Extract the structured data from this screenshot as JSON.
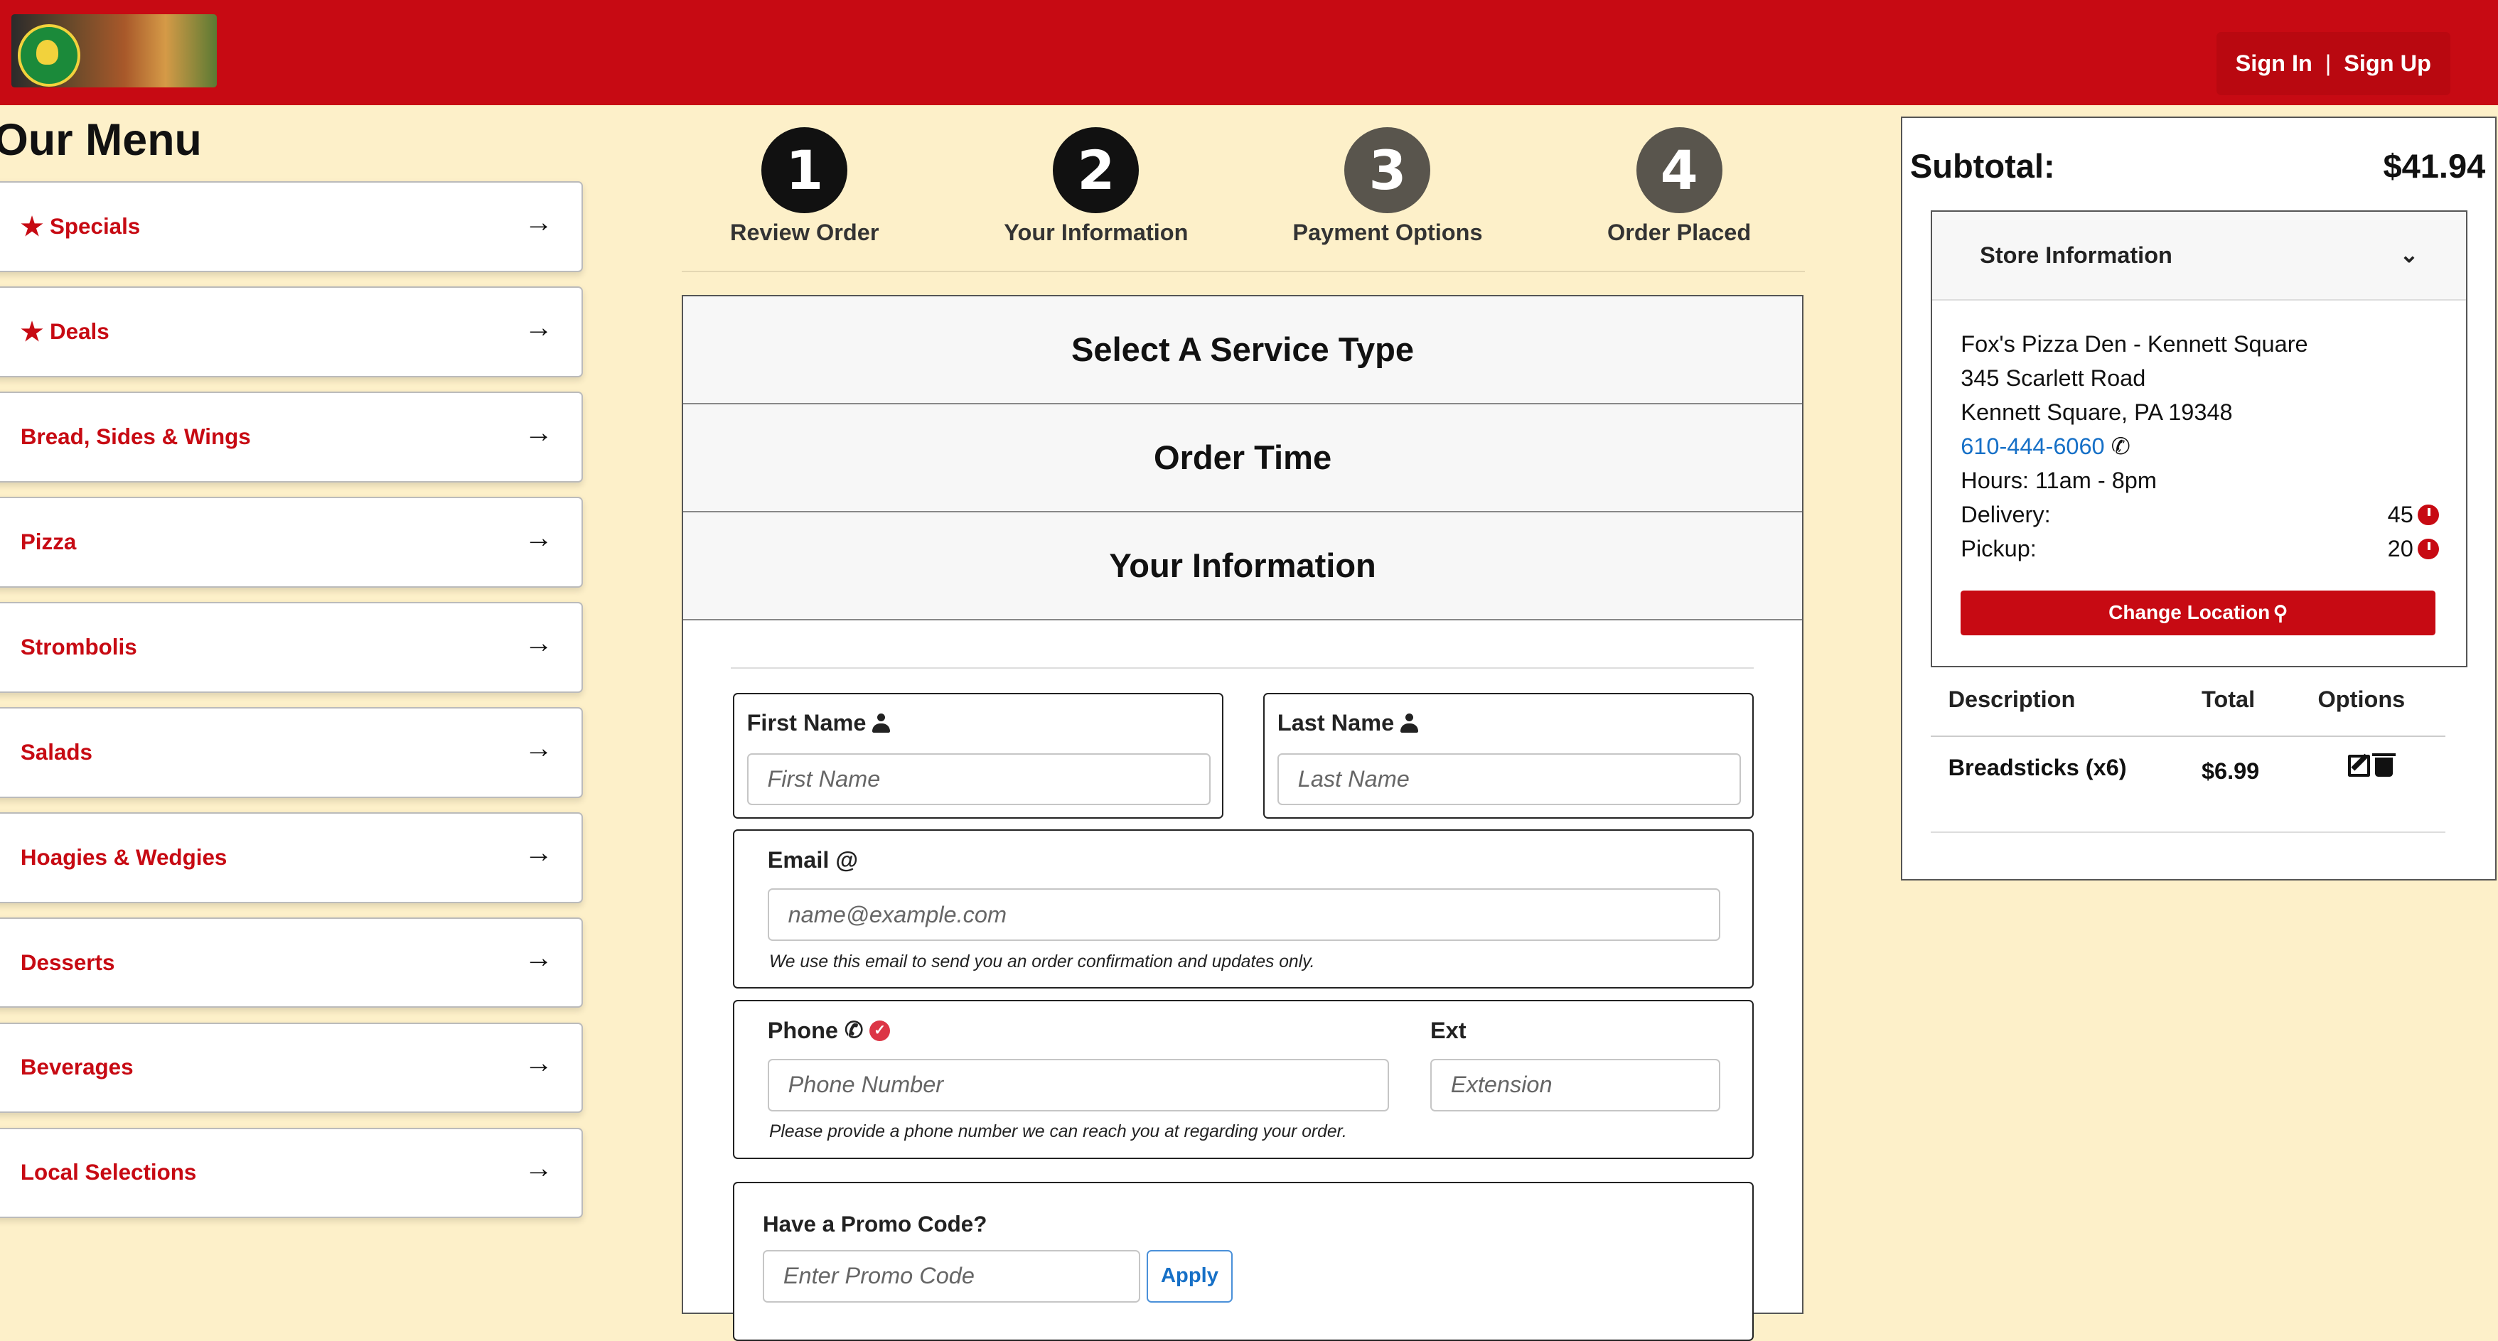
{
  "header": {
    "logo_alt": "Fox's Pizza Den",
    "sign_in": "Sign In",
    "separator": "|",
    "sign_up": "Sign Up"
  },
  "menu": {
    "title": "Our Menu",
    "items": [
      {
        "label": "Specials",
        "icon": "star-icon"
      },
      {
        "label": "Deals",
        "icon": "star-icon"
      },
      {
        "label": "Bread, Sides & Wings"
      },
      {
        "label": "Pizza"
      },
      {
        "label": "Strombolis"
      },
      {
        "label": "Salads"
      },
      {
        "label": "Hoagies & Wedgies"
      },
      {
        "label": "Desserts"
      },
      {
        "label": "Beverages"
      },
      {
        "label": "Local Selections"
      }
    ]
  },
  "steps": [
    {
      "number": "1",
      "label": "Review Order",
      "state": "complete"
    },
    {
      "number": "2",
      "label": "Your Information",
      "state": "current"
    },
    {
      "number": "3",
      "label": "Payment Options",
      "state": "pending"
    },
    {
      "number": "4",
      "label": "Order Placed",
      "state": "pending"
    }
  ],
  "checkout": {
    "section_service": "Select A Service Type",
    "section_time": "Order Time",
    "section_info": "Your Information",
    "first_name_label": "First Name",
    "first_name_placeholder": "First Name",
    "last_name_label": "Last Name",
    "last_name_placeholder": "Last Name",
    "email_label": "Email @",
    "email_placeholder": "name@example.com",
    "email_help": "We use this email to send you an order confirmation and updates only.",
    "phone_label": "Phone",
    "phone_placeholder": "Phone Number",
    "ext_label": "Ext",
    "ext_placeholder": "Extension",
    "phone_help": "Please provide a phone number we can reach you at regarding your order.",
    "promo_label": "Have a Promo Code?",
    "promo_placeholder": "Enter Promo Code",
    "apply_label": "Apply"
  },
  "cart": {
    "subtotal_label": "Subtotal:",
    "subtotal_value": "$41.94",
    "store_header": "Store Information",
    "store_name": "Fox's Pizza Den - Kennett Square",
    "address1": "345 Scarlett Road",
    "address2": "Kennett Square, PA 19348",
    "phone": "610-444-6060",
    "hours": "Hours: 11am - 8pm",
    "delivery_label": "Delivery:",
    "delivery_value": "45",
    "pickup_label": "Pickup:",
    "pickup_value": "20",
    "change_location": "Change Location",
    "table_headers": [
      "Description",
      "Total",
      "Options"
    ],
    "rows": [
      {
        "description": "Breadsticks (x6)",
        "total": "$6.99"
      }
    ]
  },
  "colors": {
    "brand_red": "#c70a13",
    "background": "#fdf0c9",
    "link_blue": "#1670c7",
    "step_active": "#111111",
    "step_pending": "#59554d"
  }
}
